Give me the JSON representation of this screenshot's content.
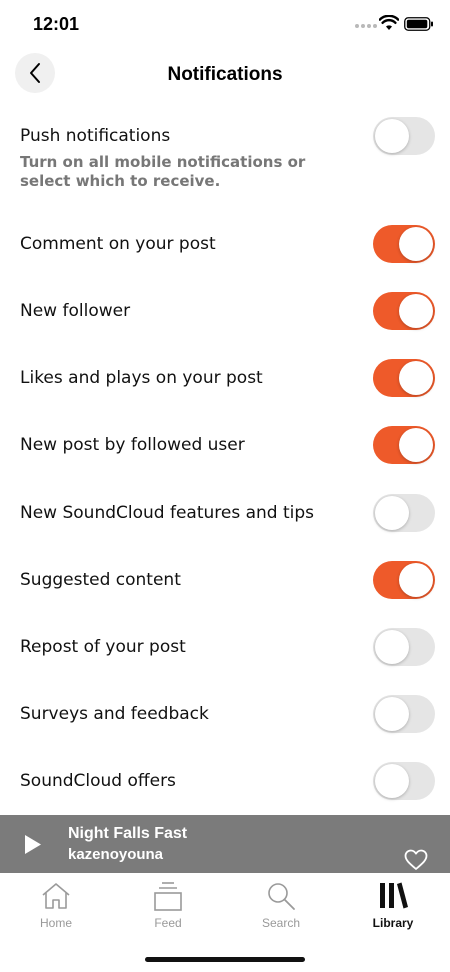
{
  "status_bar": {
    "time": "12:01"
  },
  "header": {
    "title": "Notifications"
  },
  "push": {
    "label": "Push notifications",
    "description": "Turn on all mobile notifications or select which to receive.",
    "enabled": false
  },
  "settings": [
    {
      "label": "Comment on your post",
      "enabled": true
    },
    {
      "label": "New follower",
      "enabled": true
    },
    {
      "label": "Likes and plays on your post",
      "enabled": true
    },
    {
      "label": "New post by followed user",
      "enabled": true
    },
    {
      "label": "New SoundCloud features and tips",
      "enabled": false
    },
    {
      "label": "Suggested content",
      "enabled": true
    },
    {
      "label": "Repost of your post",
      "enabled": false
    },
    {
      "label": "Surveys and feedback",
      "enabled": false
    },
    {
      "label": "SoundCloud offers",
      "enabled": false
    }
  ],
  "player": {
    "title": "Night Falls Fast",
    "artist": "kazenoyouna"
  },
  "tabs": [
    {
      "label": "Home",
      "icon": "home-icon",
      "active": false
    },
    {
      "label": "Feed",
      "icon": "feed-icon",
      "active": false
    },
    {
      "label": "Search",
      "icon": "search-icon",
      "active": false
    },
    {
      "label": "Library",
      "icon": "library-icon",
      "active": true
    }
  ],
  "colors": {
    "accent": "#ee5a2a",
    "toggle_off": "#e5e5e5",
    "player_bg": "#7b7b7b"
  }
}
